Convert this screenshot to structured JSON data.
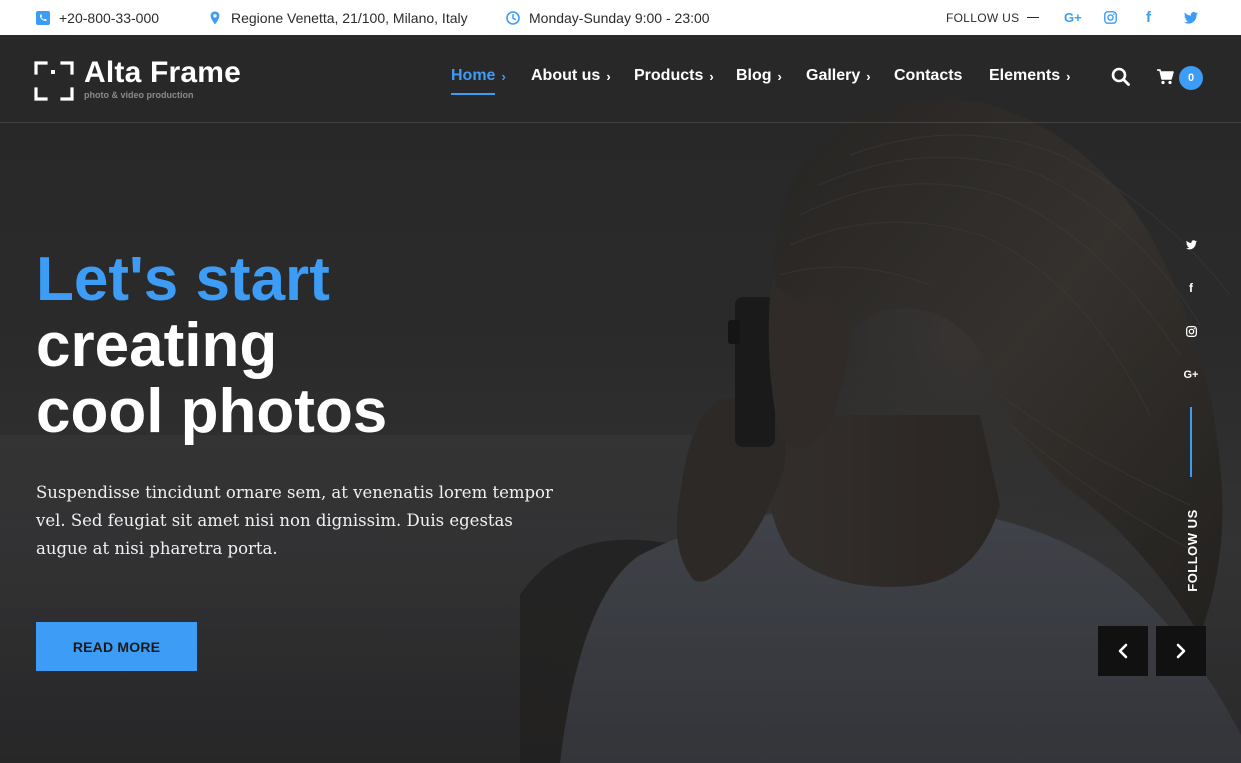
{
  "topbar": {
    "phone": "+20-800-33-000",
    "address": "Regione Venetta, 21/100, Milano, Italy",
    "hours": "Monday-Sunday 9:00 - 23:00",
    "follow_label": "FOLLOW US",
    "social": [
      {
        "icon": "google-plus-icon",
        "glyph": "G+"
      },
      {
        "icon": "instagram-icon",
        "glyph": ""
      },
      {
        "icon": "facebook-icon",
        "glyph": "f"
      },
      {
        "icon": "twitter-icon",
        "glyph": ""
      }
    ]
  },
  "brand": {
    "name": "Alta Frame",
    "tagline": "photo & video production"
  },
  "nav": {
    "items": [
      {
        "label": "Home",
        "active": true,
        "has_submenu": true
      },
      {
        "label": "About us",
        "active": false,
        "has_submenu": true
      },
      {
        "label": "Products",
        "active": false,
        "has_submenu": true
      },
      {
        "label": "Blog",
        "active": false,
        "has_submenu": true
      },
      {
        "label": "Gallery",
        "active": false,
        "has_submenu": true
      },
      {
        "label": "Contacts",
        "active": false,
        "has_submenu": false
      },
      {
        "label": "Elements",
        "active": false,
        "has_submenu": true
      }
    ],
    "submenu_glyph": "›",
    "cart_count": "0"
  },
  "hero": {
    "headline_line1": "Let's start",
    "headline_line2": "creating",
    "headline_line3": "cool photos",
    "lead": "Suspendisse tincidunt ornare sem, at venenatis lorem tempor vel. Sed feugiat sit amet nisi non dignissim. Duis egestas augue at nisi pharetra porta.",
    "cta_label": "READ MORE",
    "side_social": [
      {
        "icon": "twitter-icon"
      },
      {
        "icon": "facebook-icon",
        "glyph": "f"
      },
      {
        "icon": "instagram-icon"
      },
      {
        "icon": "google-plus-icon",
        "glyph": "G+"
      }
    ],
    "side_follow_label": "FOLLOW US"
  },
  "colors": {
    "accent": "#3d9cf5",
    "topbar_bg": "#ffffff",
    "hero_overlay": "#2b2b2b",
    "arrow_bg": "#111111"
  }
}
